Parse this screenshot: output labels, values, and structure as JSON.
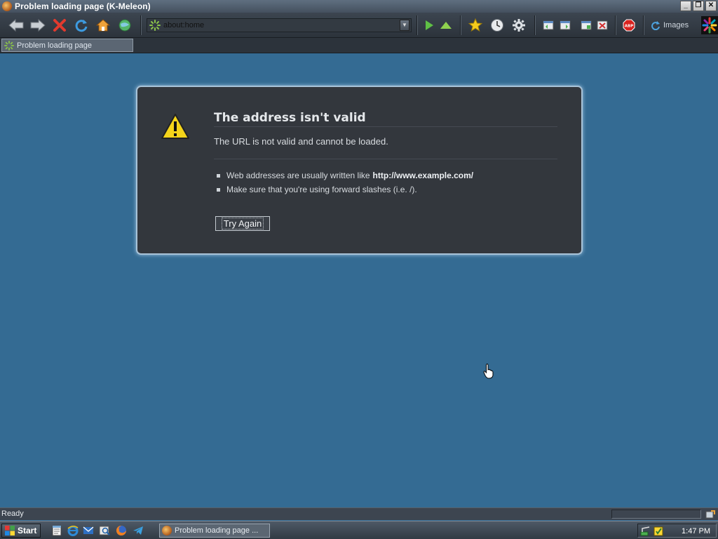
{
  "window": {
    "title": "Problem loading page (K-Meleon)"
  },
  "toolbar": {
    "url": "about:home",
    "images_label": "Images"
  },
  "tab": {
    "label": "Problem loading page"
  },
  "error": {
    "title": "The address isn't valid",
    "description": "The URL is not valid and cannot be loaded.",
    "hints": [
      {
        "text": "Web addresses are usually written like",
        "bold": "http://www.example.com/"
      },
      {
        "text": "Make sure that you're using forward slashes (i.e. /).",
        "bold": ""
      }
    ],
    "button": "Try Again"
  },
  "status": {
    "text": "Ready"
  },
  "taskbar": {
    "start": "Start",
    "task_label": "Problem loading page ...",
    "clock": "1:47 PM"
  },
  "colors": {
    "background": "#346b93",
    "error_box": "#33373d",
    "toolbar": "#2f363e",
    "accent_glow": "#9fc4e0"
  }
}
